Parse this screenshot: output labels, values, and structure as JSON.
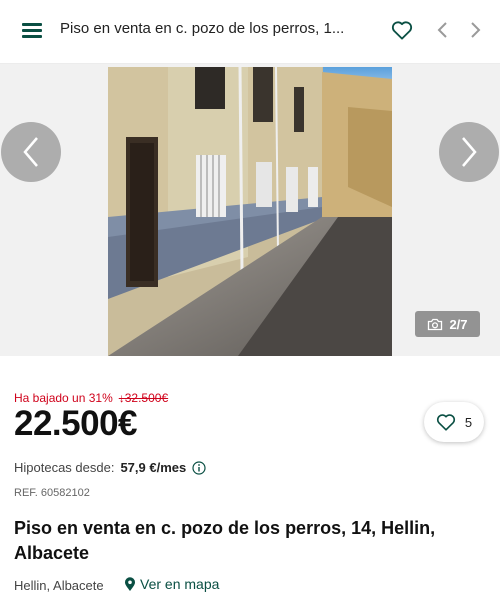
{
  "header": {
    "title": "Piso en venta en c. pozo de los perros, 1...",
    "menu_icon": "hamburger-menu-icon",
    "favorite_icon": "heart-outline-icon",
    "prev_icon": "chevron-left-icon",
    "next_icon": "chevron-right-icon"
  },
  "gallery": {
    "counter": "2/7",
    "counter_icon": "camera-icon",
    "prev_icon": "chevron-left-icon",
    "next_icon": "chevron-right-icon"
  },
  "listing": {
    "price_drop_text": "Ha bajado un 31%",
    "old_price": "↓32.500€",
    "price": "22.500€",
    "favorites_count": "5",
    "mortgage_label": "Hipotecas desde:",
    "mortgage_value": "57,9 €/mes",
    "reference": "REF. 60582102",
    "title": "Piso en venta en c. pozo de los perros, 14, Hellin, Albacete",
    "location": "Hellin, Albacete",
    "map_link": "Ver en mapa"
  },
  "colors": {
    "brand": "#0a4f43",
    "price_drop": "#d0021b"
  }
}
